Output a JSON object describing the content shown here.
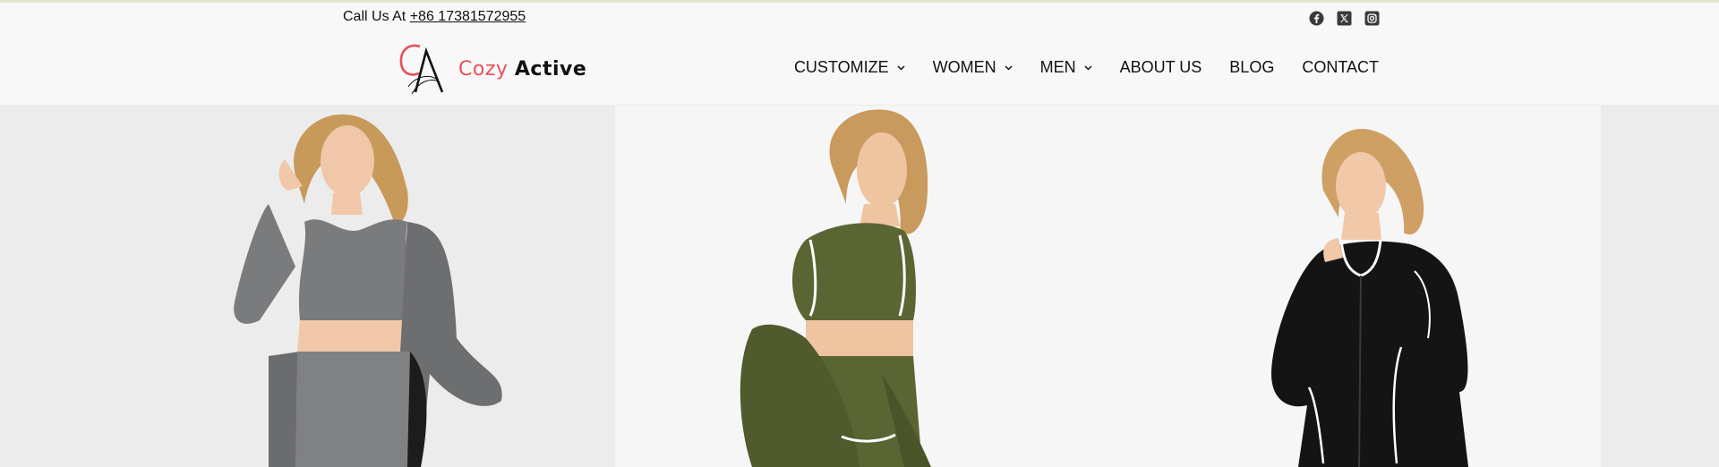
{
  "topbar": {
    "call_label": "Call Us At",
    "phone": "+86 17381572955",
    "social_icons": [
      "facebook-icon",
      "x-twitter-icon",
      "instagram-icon"
    ]
  },
  "header": {
    "logo": {
      "word1": "Cozy",
      "word2": "Active",
      "mark": "CA"
    },
    "nav": [
      {
        "label": "CUSTOMIZE",
        "has_dropdown": true
      },
      {
        "label": "WOMEN",
        "has_dropdown": true
      },
      {
        "label": "MEN",
        "has_dropdown": true
      },
      {
        "label": "ABOUT US",
        "has_dropdown": false
      },
      {
        "label": "BLOG",
        "has_dropdown": false
      },
      {
        "label": "CONTACT",
        "has_dropdown": false
      }
    ]
  },
  "hero": {
    "images": [
      "grey-activewear-model",
      "olive-activewear-model",
      "black-activewear-model"
    ]
  },
  "colors": {
    "accent": "#e8505b",
    "text": "#111111",
    "header_bg": "#f8f8f8",
    "outfit_grey": "#7a7b7d",
    "outfit_olive": "#5a6534",
    "outfit_black": "#141414"
  }
}
